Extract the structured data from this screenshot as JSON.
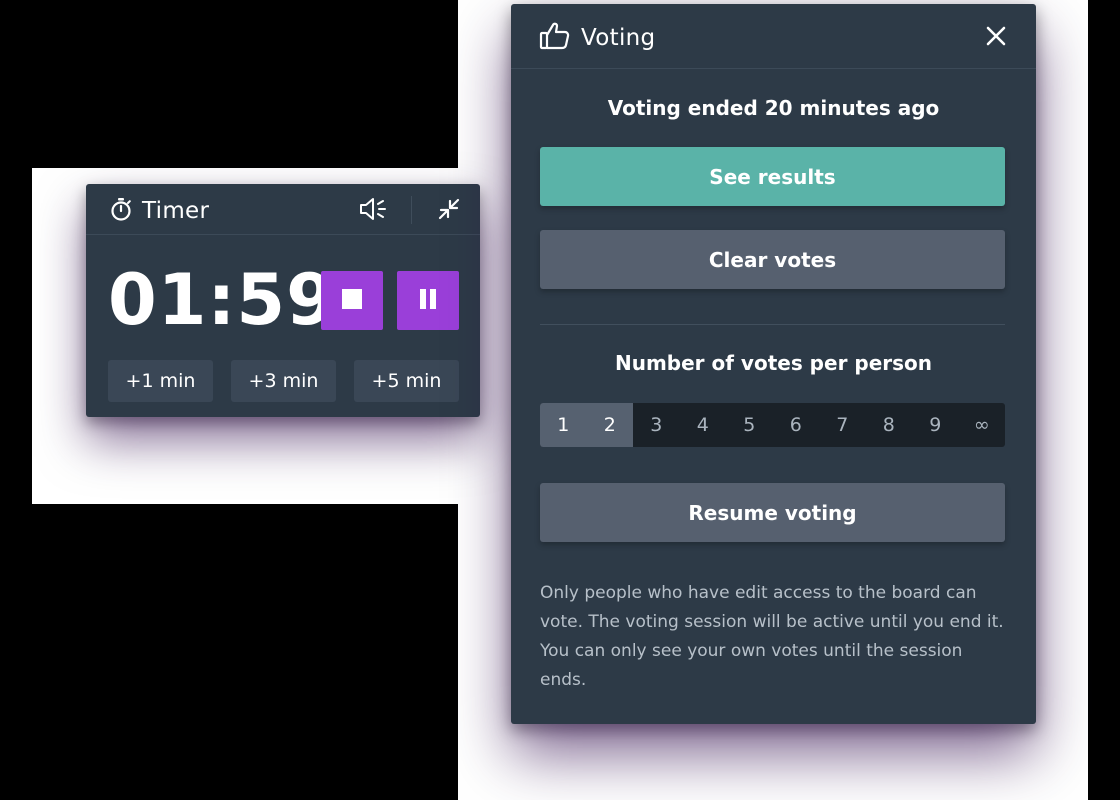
{
  "timer": {
    "title": "Timer",
    "time": "01:59",
    "add_buttons": [
      "+1 min",
      "+3 min",
      "+5 min"
    ]
  },
  "voting": {
    "title": "Voting",
    "status": "Voting ended 20 minutes ago",
    "see_results_label": "See results",
    "clear_votes_label": "Clear votes",
    "votes_per_person_label": "Number of votes per person",
    "vote_options": [
      "1",
      "2",
      "3",
      "4",
      "5",
      "6",
      "7",
      "8",
      "9",
      "∞"
    ],
    "selected_votes": "2",
    "resume_label": "Resume voting",
    "note": "Only people who have edit access to the board can vote. The voting session will be active until you end it. You can only see your own votes until the session ends."
  },
  "colors": {
    "panel_bg": "#2d3a47",
    "accent_purple": "#9a3fd9",
    "accent_teal": "#5ab3a8",
    "secondary_button": "#56606f"
  },
  "icons": [
    "stopwatch-icon",
    "speaker-icon",
    "minimize-icon",
    "stop-icon",
    "pause-icon",
    "thumbs-up-icon",
    "close-icon"
  ]
}
